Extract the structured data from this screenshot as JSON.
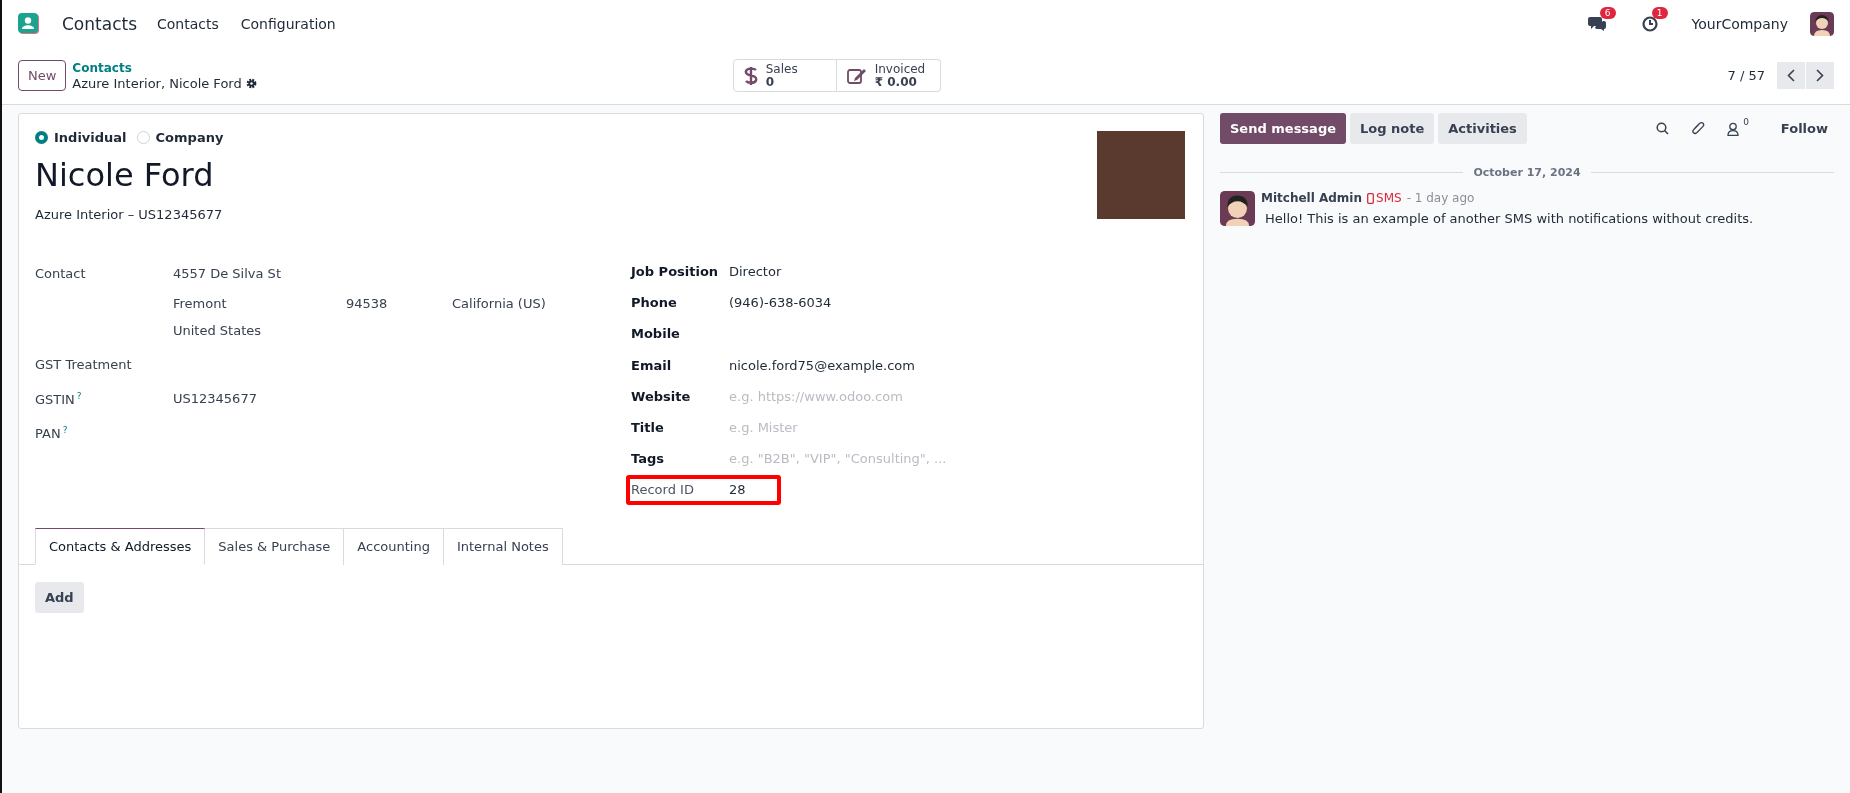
{
  "navbar": {
    "app_name": "Contacts",
    "menus": [
      "Contacts",
      "Configuration"
    ],
    "messages_badge": "6",
    "activities_badge": "1",
    "company": "YourCompany"
  },
  "control_panel": {
    "new_button": "New",
    "breadcrumb": "Contacts",
    "record_title": "Azure Interior, Nicole Ford",
    "smart_buttons": [
      {
        "kind": "sales",
        "label": "Sales",
        "value": "0"
      },
      {
        "kind": "invoiced",
        "label": "Invoiced",
        "value": "₹ 0.00"
      }
    ],
    "pager": "7 / 57"
  },
  "form": {
    "type_options": [
      {
        "label": "Individual",
        "selected": true
      },
      {
        "label": "Company",
        "selected": false
      }
    ],
    "name": "Nicole Ford",
    "subtitle": "Azure Interior – US12345677",
    "address": {
      "label": "Contact",
      "street": "4557 De Silva St",
      "city": "Fremont",
      "zip": "94538",
      "state": "California (US)",
      "country": "United States"
    },
    "left_fields": [
      {
        "label": "GST Treatment"
      },
      {
        "label": "GSTIN",
        "help": "?",
        "value": "US12345677"
      },
      {
        "label": "PAN",
        "help": "?"
      }
    ],
    "right_fields": [
      {
        "kind": "input",
        "label": "Job Position",
        "value": "Director",
        "highlighted": false
      },
      {
        "kind": "input",
        "label": "Phone",
        "value": "(946)-638-6034",
        "highlighted": false
      },
      {
        "kind": "input",
        "label": "Mobile",
        "highlighted": false
      },
      {
        "kind": "input",
        "label": "Email",
        "value": "nicole.ford75@example.com",
        "highlighted": false
      },
      {
        "kind": "input",
        "label": "Website",
        "placeholder": "e.g. https://www.odoo.com",
        "highlighted": false
      },
      {
        "kind": "input",
        "label": "Title",
        "placeholder": "e.g. Mister",
        "highlighted": false
      },
      {
        "kind": "input",
        "label": "Tags",
        "placeholder": "e.g. \"B2B\", \"VIP\", \"Consulting\", ...",
        "highlighted": false
      },
      {
        "kind": "readonly",
        "label": "Record ID",
        "value": "28",
        "highlighted": true
      }
    ],
    "tabs": [
      {
        "label": "Contacts & Addresses",
        "selected": true
      },
      {
        "label": "Sales & Purchase",
        "selected": false
      },
      {
        "label": "Accounting",
        "selected": false
      },
      {
        "label": "Internal Notes",
        "selected": false
      }
    ],
    "add_button": "Add"
  },
  "chatter": {
    "buttons": [
      {
        "label": "Send message",
        "selected": true
      },
      {
        "label": "Log note",
        "selected": false
      },
      {
        "label": "Activities",
        "selected": false
      }
    ],
    "followers_count": "0",
    "follow": "Follow",
    "date": "October 17, 2024",
    "messages": [
      {
        "author": "Mitchell Admin",
        "channel": "SMS",
        "time": "- 1 day ago",
        "body": "Hello! This is an example of another SMS with notifications without credits."
      }
    ]
  }
}
